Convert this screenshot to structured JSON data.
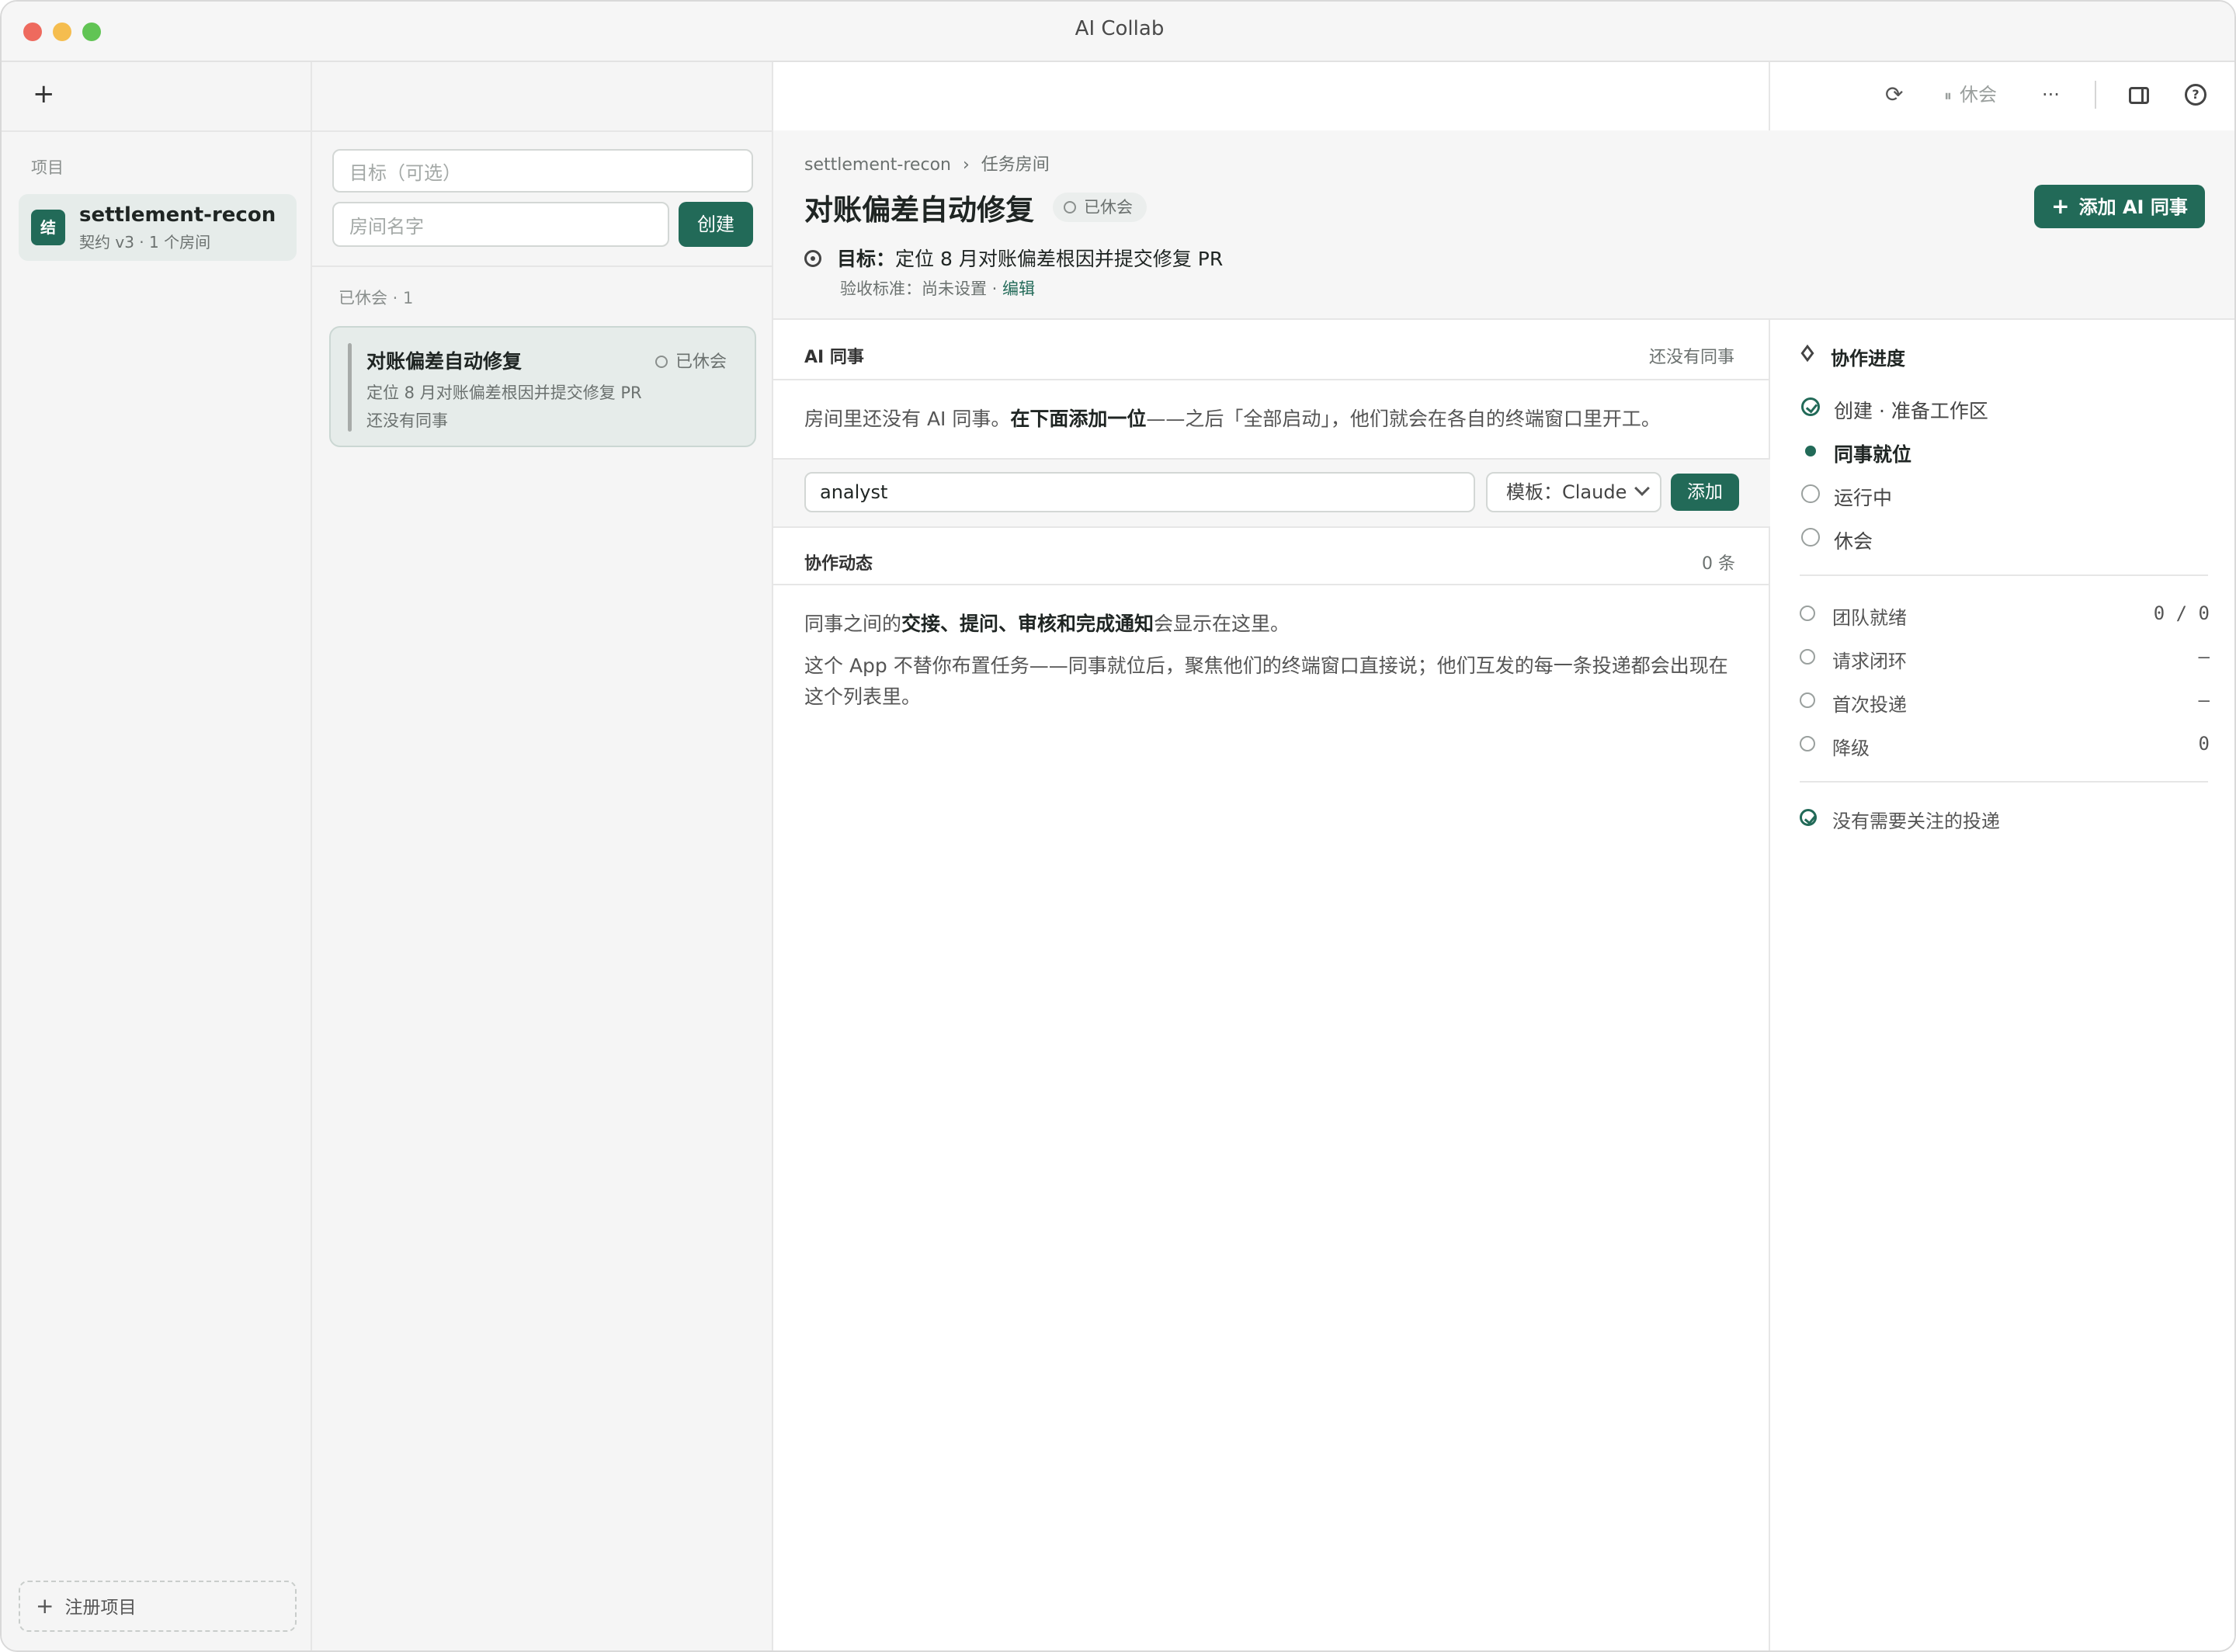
{
  "window": {
    "title": "AI Collab",
    "traffic_colors": [
      "#ee6a5e",
      "#f5bd4f",
      "#61c454"
    ]
  },
  "sidebar": {
    "section_label": "项目",
    "project": {
      "avatar": "结",
      "name": "settlement-recon",
      "meta": "契约 v3 · 1 个房间"
    },
    "register_label": "注册项目"
  },
  "room_form": {
    "goal_placeholder": "目标（可选）",
    "name_placeholder": "房间名字",
    "create_label": "创建",
    "group_label": "已休会 · 1"
  },
  "room_card": {
    "title": "对账偏差自动修复",
    "status": "已休会",
    "goal": "定位 8 月对账偏差根因并提交修复 PR",
    "members": "还没有同事"
  },
  "toolbar": {
    "recess_label": "休会",
    "more": "···"
  },
  "header": {
    "breadcrumb_project": "settlement-recon",
    "breadcrumb_sep": "›",
    "breadcrumb_page": "任务房间",
    "title": "对账偏差自动修复",
    "status": "已休会",
    "add_ai_label": "添加 AI 同事",
    "goal_label": "目标：",
    "goal_text": "定位 8 月对账偏差根因并提交修复 PR",
    "accept_label": "验收标准：尚未设置 · ",
    "accept_edit": "编辑"
  },
  "colleagues": {
    "title": "AI 同事",
    "right": "还没有同事",
    "note_pre": "房间里还没有 AI 同事。",
    "note_bold": "在下面添加一位",
    "note_post": "——之后「全部启动」，他们就会在各自的终端窗口里开工。",
    "name_value": "analyst",
    "template_value": "模板：Claude",
    "add_label": "添加"
  },
  "feed": {
    "title": "协作动态",
    "count": "0 条",
    "line1_pre": "同事之间的",
    "line1_bold": "交接、提问、审核和完成通知",
    "line1_post": "会显示在这里。",
    "line2": "这个 App 不替你布置任务——同事就位后，聚焦他们的终端窗口直接说；他们互发的每一条投递都会出现在这个列表里。"
  },
  "progress": {
    "title": "协作进度",
    "steps": [
      {
        "label": "创建 · 准备工作区",
        "state": "done"
      },
      {
        "label": "同事就位",
        "state": "current"
      },
      {
        "label": "运行中",
        "state": "todo"
      },
      {
        "label": "休会",
        "state": "todo"
      }
    ],
    "stats": [
      {
        "label": "团队就绪",
        "value": "0 / 0"
      },
      {
        "label": "请求闭环",
        "value": "—"
      },
      {
        "label": "首次投递",
        "value": "—"
      },
      {
        "label": "降级",
        "value": "0"
      }
    ],
    "footer": "没有需要关注的投递"
  },
  "accent": "#226a58"
}
